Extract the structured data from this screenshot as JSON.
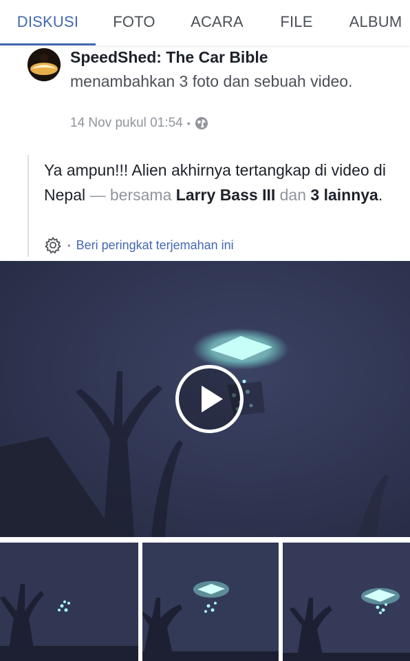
{
  "tabs": [
    {
      "label": "DISKUSI",
      "active": true
    },
    {
      "label": "FOTO",
      "active": false
    },
    {
      "label": "ACARA",
      "active": false
    },
    {
      "label": "FILE",
      "active": false
    },
    {
      "label": "ALBUM",
      "active": false
    }
  ],
  "post": {
    "author": "SpeedShed: The Car Bible",
    "action": "menambahkan 3 foto dan sebuah video.",
    "timestamp": "14 Nov pukul 01:54",
    "separator": "•",
    "privacy_icon": "globe-icon"
  },
  "shared": {
    "text_main": "Ya ampun!!! Alien akhirnya tertangkap di video di Nepal",
    "dash_with": " — bersama ",
    "tagged_person": "Larry Bass III",
    "and": " dan ",
    "others": "3 lainnya",
    "period": ".",
    "translate_label": "Beri peringkat terjemahan ini",
    "translate_separator": "•"
  },
  "media": {
    "video_icon": "play-icon",
    "photo_count": 3
  },
  "colors": {
    "accent": "#4267b2",
    "night_sky": "#2f3550",
    "ufo_glow": "#a8fff4"
  }
}
